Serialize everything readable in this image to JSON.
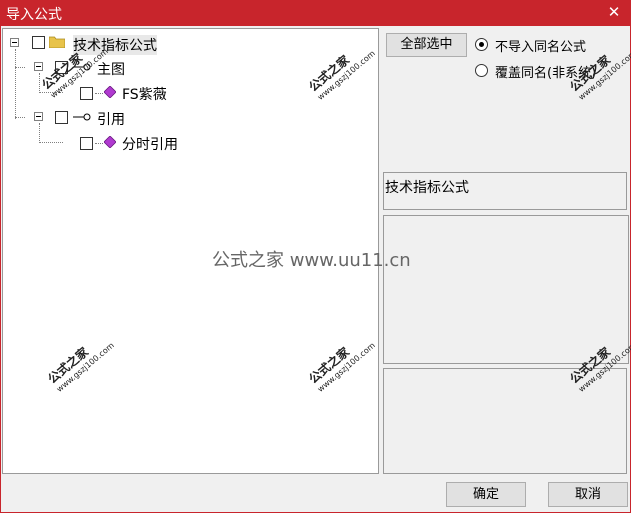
{
  "window": {
    "title": "导入公式",
    "close_glyph": "✕"
  },
  "tree": {
    "root": {
      "label": "技术指标公式"
    },
    "main": {
      "label": "主图"
    },
    "main_child": {
      "label": "FS紫薇"
    },
    "ref": {
      "label": "引用"
    },
    "ref_child": {
      "label": "分时引用"
    }
  },
  "options": {
    "select_all_label": "全部选中",
    "radio_no_import": "不导入同名公式",
    "radio_overwrite": "覆盖同名(非系统)",
    "selected": "radio_no_import"
  },
  "info": {
    "category_text": "技术指标公式"
  },
  "buttons": {
    "ok": "确定",
    "cancel": "取消"
  },
  "watermark": {
    "cn": "公式之家",
    "url": "www.gszj100.com",
    "center": "公式之家 www.uu11.cn"
  }
}
